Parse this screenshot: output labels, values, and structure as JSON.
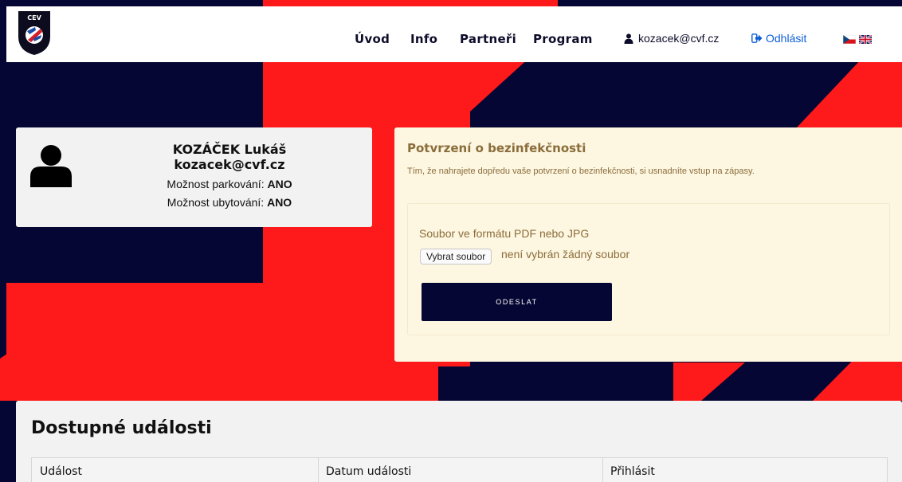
{
  "header": {
    "logo_text": "CEV",
    "nav": [
      "Úvod",
      "Info",
      "Partneři",
      "Program"
    ],
    "user_email": "kozacek@cvf.cz",
    "logout_label": "Odhlásit",
    "languages": [
      "cs",
      "en"
    ]
  },
  "profile": {
    "name": "KOZÁČEK Lukáš",
    "email": "kozacek@cvf.cz",
    "parking_label": "Možnost parkování:",
    "parking_value": "ANO",
    "lodging_label": "Možnost ubytování:",
    "lodging_value": "ANO"
  },
  "upload": {
    "title": "Potvrzení o bezinfekčnosti",
    "description": "Tím, že nahrajete dopředu vaše potvrzení o bezinfekčnosti, si usnadníte vstup na zápasy.",
    "file_label": "Soubor ve formátu PDF nebo JPG",
    "choose_button": "Vybrat soubor",
    "file_status": "není vybrán žádný soubor",
    "submit_label": "ODESLAT"
  },
  "events": {
    "title": "Dostupné události",
    "columns": [
      "Událost",
      "Datum události",
      "Přihlásit"
    ]
  },
  "colors": {
    "navy": "#050633",
    "red": "#fe1a1a",
    "warning_bg": "#fdf6e0",
    "warning_text": "#8a6d3b"
  }
}
